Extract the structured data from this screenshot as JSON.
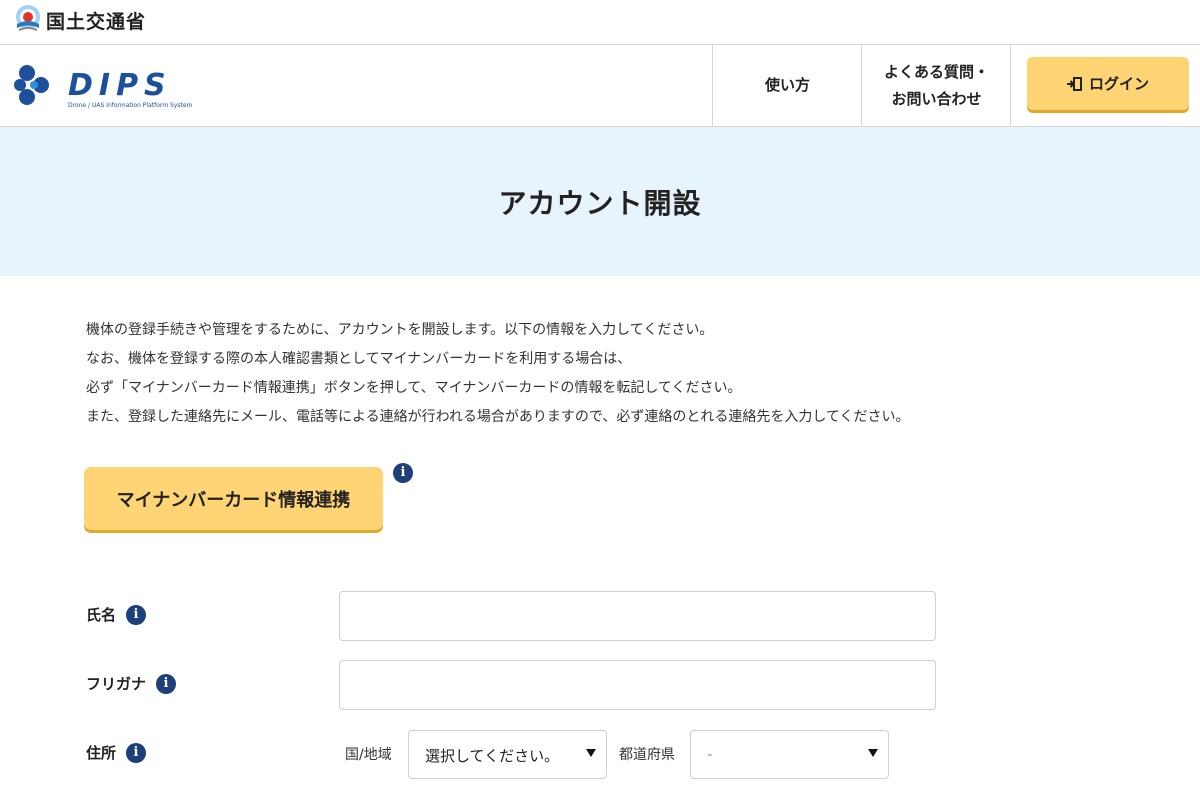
{
  "ministry": {
    "name": "国土交通省",
    "logo_icon": "mlit-logo-icon"
  },
  "header": {
    "logo_text": "DIPS",
    "logo_subtitle": "Drone / UAS Information Platform System",
    "nav_howto": "使い方",
    "nav_faq_line1": "よくある質問・",
    "nav_faq_line2": "お問い合わせ",
    "login_label": "ログイン",
    "login_icon": "login-door-icon"
  },
  "banner": {
    "title": "アカウント開設"
  },
  "intro": {
    "lines": [
      "機体の登録手続きや管理をするために、アカウントを開設します。以下の情報を入力してください。",
      "なお、機体を登録する際の本人確認書類としてマイナンバーカードを利用する場合は、",
      "必ず「マイナンバーカード情報連携」ボタンを押して、マイナンバーカードの情報を転記してください。",
      "また、登録した連絡先にメール、電話等による連絡が行われる場合がありますので、必ず連絡のとれる連絡先を入力してください。"
    ]
  },
  "mynumber": {
    "button_label": "マイナンバーカード情報連携",
    "info_icon": "i"
  },
  "form": {
    "name_label": "氏名",
    "name_value": "",
    "furigana_label": "フリガナ",
    "furigana_value": "",
    "address_label": "住所",
    "country_label": "国/地域",
    "country_value": "選択してください。",
    "prefecture_label": "都道府県",
    "prefecture_value": "-",
    "info_icon": "i"
  },
  "colors": {
    "accent_button": "#ffd474",
    "banner_bg": "#e8f4fc",
    "info_icon": "#1f3f7a",
    "logo_blue": "#1e4f9c"
  }
}
